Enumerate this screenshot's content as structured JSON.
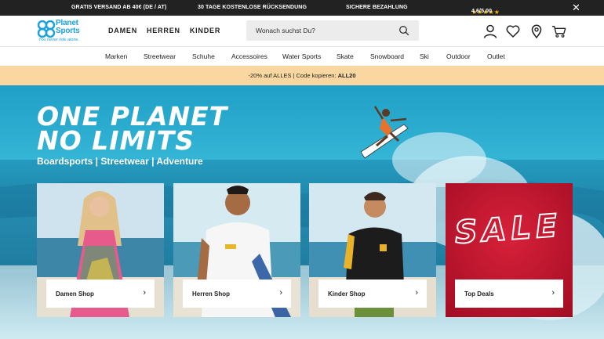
{
  "topbar": {
    "item1": "GRATIS VERSAND AB 40€ (DE / AT)",
    "item2": "30 TAGE KOSTENLOSE RÜCKSENDUNG",
    "item3": "SICHERE BEZAHLUNG",
    "stars": "★★★★★",
    "rating": "4.6/5.00",
    "close": "✕"
  },
  "logo": {
    "line1": "Planet",
    "line2": "Sports",
    "tagline": "You never ride alone."
  },
  "gender_nav": [
    "DAMEN",
    "HERREN",
    "KINDER"
  ],
  "search": {
    "placeholder": "Wonach suchst Du?"
  },
  "categories": [
    "Marken",
    "Streetwear",
    "Schuhe",
    "Accessoires",
    "Water Sports",
    "Skate",
    "Snowboard",
    "Ski",
    "Outdoor",
    "Outlet"
  ],
  "promo": {
    "text": "-20% auf ALLES | Code kopieren: ",
    "code": "ALL20"
  },
  "hero": {
    "title_line1": "ONE PLANET",
    "title_line2": "NO LIMITS",
    "subtitle": "Boardsports  |  Streetwear  |  Adventure"
  },
  "cards": [
    {
      "label": "Damen Shop"
    },
    {
      "label": "Herren Shop"
    },
    {
      "label": "Kinder Shop"
    },
    {
      "label": "Top Deals",
      "overlay": "SALE"
    }
  ],
  "colors": {
    "brand": "#1aa0dc",
    "promo_bg": "#fad7a0",
    "sale_red": "#c8102e",
    "stars": "#f5b400"
  },
  "icons": [
    "user-icon",
    "heart-icon",
    "location-pin-icon",
    "cart-icon",
    "search-icon",
    "chevron-right-icon"
  ]
}
